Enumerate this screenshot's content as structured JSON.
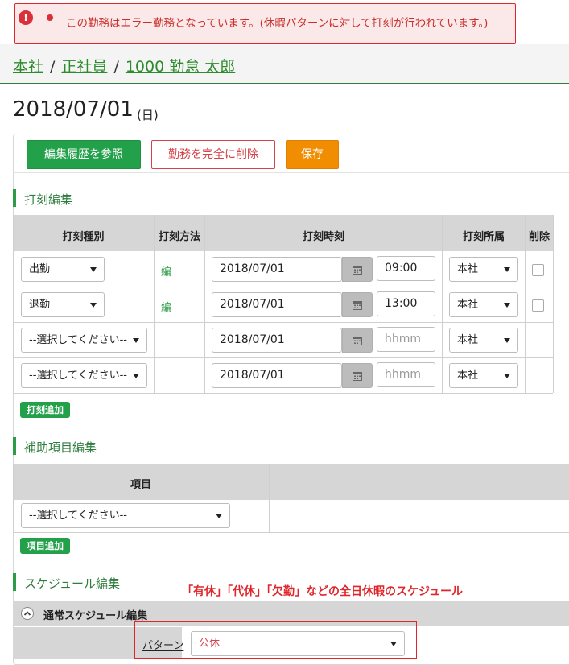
{
  "alert": {
    "message": "この勤務はエラー勤務となっています。(休暇パターンに対して打刻が行われています。)"
  },
  "breadcrumb": {
    "items": [
      "本社",
      "正社員",
      "1000 勤怠 太郎"
    ],
    "separator": "/"
  },
  "date": {
    "value": "2018/07/01",
    "weekday": "(日)"
  },
  "toolbar": {
    "history_label": "編集履歴を参照",
    "delete_label": "勤務を完全に削除",
    "save_label": "保存"
  },
  "stamp_section": {
    "title": "打刻編集",
    "headers": [
      "打刻種別",
      "打刻方法",
      "打刻時刻",
      "打刻所属",
      "削除"
    ],
    "rows": [
      {
        "type": "出勤",
        "method": "編",
        "date": "2018/07/01",
        "time": "09:00",
        "time_placeholder": "",
        "org": "本社",
        "deletable": true
      },
      {
        "type": "退勤",
        "method": "編",
        "date": "2018/07/01",
        "time": "13:00",
        "time_placeholder": "",
        "org": "本社",
        "deletable": true
      },
      {
        "type": "--選択してください--",
        "method": "",
        "date": "2018/07/01",
        "time": "",
        "time_placeholder": "hhmm",
        "org": "本社",
        "deletable": false
      },
      {
        "type": "--選択してください--",
        "method": "",
        "date": "2018/07/01",
        "time": "",
        "time_placeholder": "hhmm",
        "org": "本社",
        "deletable": false
      }
    ],
    "add_label": "打刻追加"
  },
  "aux_section": {
    "title": "補助項目編集",
    "header": "項目",
    "select_value": "--選択してください--",
    "add_label": "項目追加"
  },
  "schedule_section": {
    "title": "スケジュール編集",
    "annotation": "「有休」「代休」「欠勤」などの全日休暇のスケジュール",
    "accordion_label": "通常スケジュール編集",
    "pattern_label": "パターン",
    "pattern_value": "公休"
  },
  "colors": {
    "accent_green": "#23a04a",
    "danger_red": "#e0262b",
    "save_orange": "#f18d00"
  }
}
